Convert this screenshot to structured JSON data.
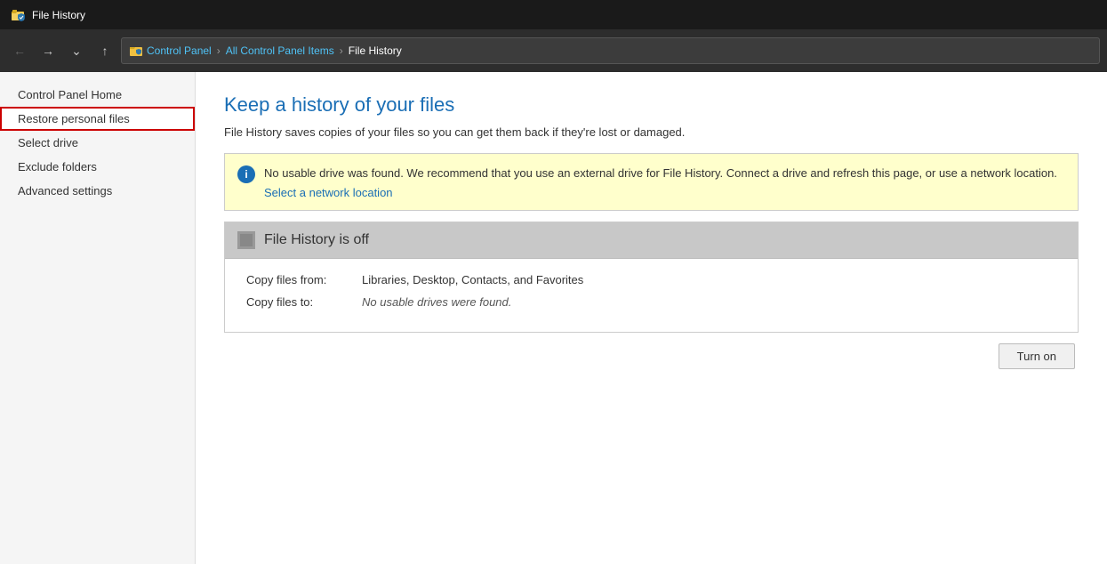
{
  "titleBar": {
    "icon": "📁",
    "title": "File History"
  },
  "navBar": {
    "backLabel": "←",
    "forwardLabel": "→",
    "downLabel": "⌄",
    "upLabel": "↑",
    "breadcrumbs": [
      "Control Panel",
      "All Control Panel Items",
      "File History"
    ]
  },
  "sidebar": {
    "items": [
      {
        "id": "control-panel-home",
        "label": "Control Panel Home",
        "active": false
      },
      {
        "id": "restore-personal-files",
        "label": "Restore personal files",
        "active": true
      },
      {
        "id": "select-drive",
        "label": "Select drive",
        "active": false
      },
      {
        "id": "exclude-folders",
        "label": "Exclude folders",
        "active": false
      },
      {
        "id": "advanced-settings",
        "label": "Advanced settings",
        "active": false
      }
    ]
  },
  "content": {
    "title": "Keep a history of your files",
    "description": "File History saves copies of your files so you can get them back if they're lost or damaged.",
    "warningBox": {
      "message": "No usable drive was found. We recommend that you use an external drive for File History. Connect a drive and refresh this page, or use a network location.",
      "linkLabel": "Select a network location"
    },
    "statusBox": {
      "title": "File History is off",
      "rows": [
        {
          "label": "Copy files from:",
          "value": "Libraries, Desktop, Contacts, and Favorites",
          "italic": false
        },
        {
          "label": "Copy files to:",
          "value": "No usable drives were found.",
          "italic": true
        }
      ]
    },
    "turnOnButton": "Turn on"
  }
}
